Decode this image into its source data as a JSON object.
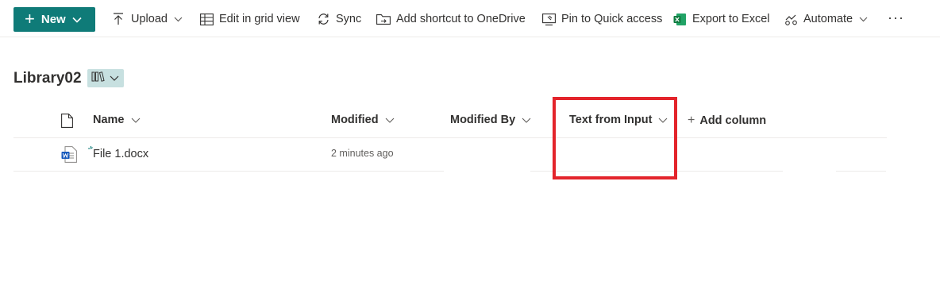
{
  "command_bar": {
    "new_label": "New",
    "upload_label": "Upload",
    "edit_grid_label": "Edit in grid view",
    "sync_label": "Sync",
    "add_shortcut_label": "Add shortcut to OneDrive",
    "pin_label": "Pin to Quick access",
    "export_label": "Export to Excel",
    "automate_label": "Automate",
    "more_label": "···"
  },
  "library": {
    "title": "Library02"
  },
  "columns": {
    "name": "Name",
    "modified": "Modified",
    "modified_by": "Modified By",
    "text_from_input": "Text from Input",
    "add_column": "Add column"
  },
  "rows": [
    {
      "name": "File 1.docx",
      "modified": "2 minutes ago",
      "modified_by": "",
      "text_from_input": ""
    }
  ],
  "colors": {
    "accent": "#0f7b78",
    "view_switch_bg": "#c7e0e0",
    "highlight": "#e3242b",
    "word_blue": "#185abd",
    "excel_green": "#107c41"
  }
}
